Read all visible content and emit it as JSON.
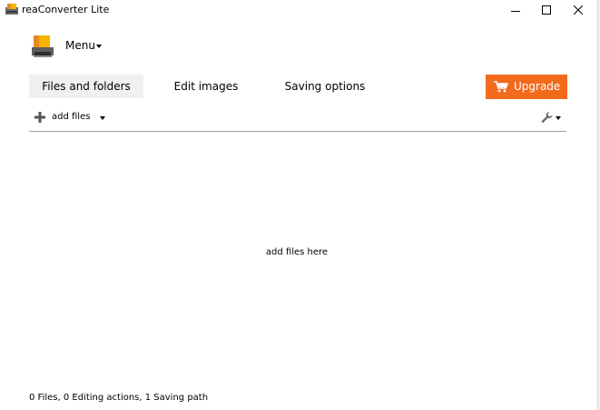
{
  "window": {
    "title": "reaConverter Lite",
    "controls": {
      "minimize_icon": "minimize-icon",
      "maximize_icon": "maximize-icon",
      "close_icon": "close-icon"
    }
  },
  "menu": {
    "label": "Menu",
    "icon": "app-logo-icon"
  },
  "tabs": [
    {
      "label": "Files and folders",
      "active": true
    },
    {
      "label": "Edit images",
      "active": false
    },
    {
      "label": "Saving options",
      "active": false
    }
  ],
  "upgrade": {
    "label": "Upgrade",
    "icon": "cart-icon",
    "color": "#f26b1d"
  },
  "toolbar": {
    "add_files_label": "add files",
    "add_icon": "plus-icon",
    "tools_icon": "wrench-icon"
  },
  "drop_area": {
    "hint": "add files here"
  },
  "status": {
    "text": "0 Files, 0 Editing actions, 1 Saving path"
  }
}
